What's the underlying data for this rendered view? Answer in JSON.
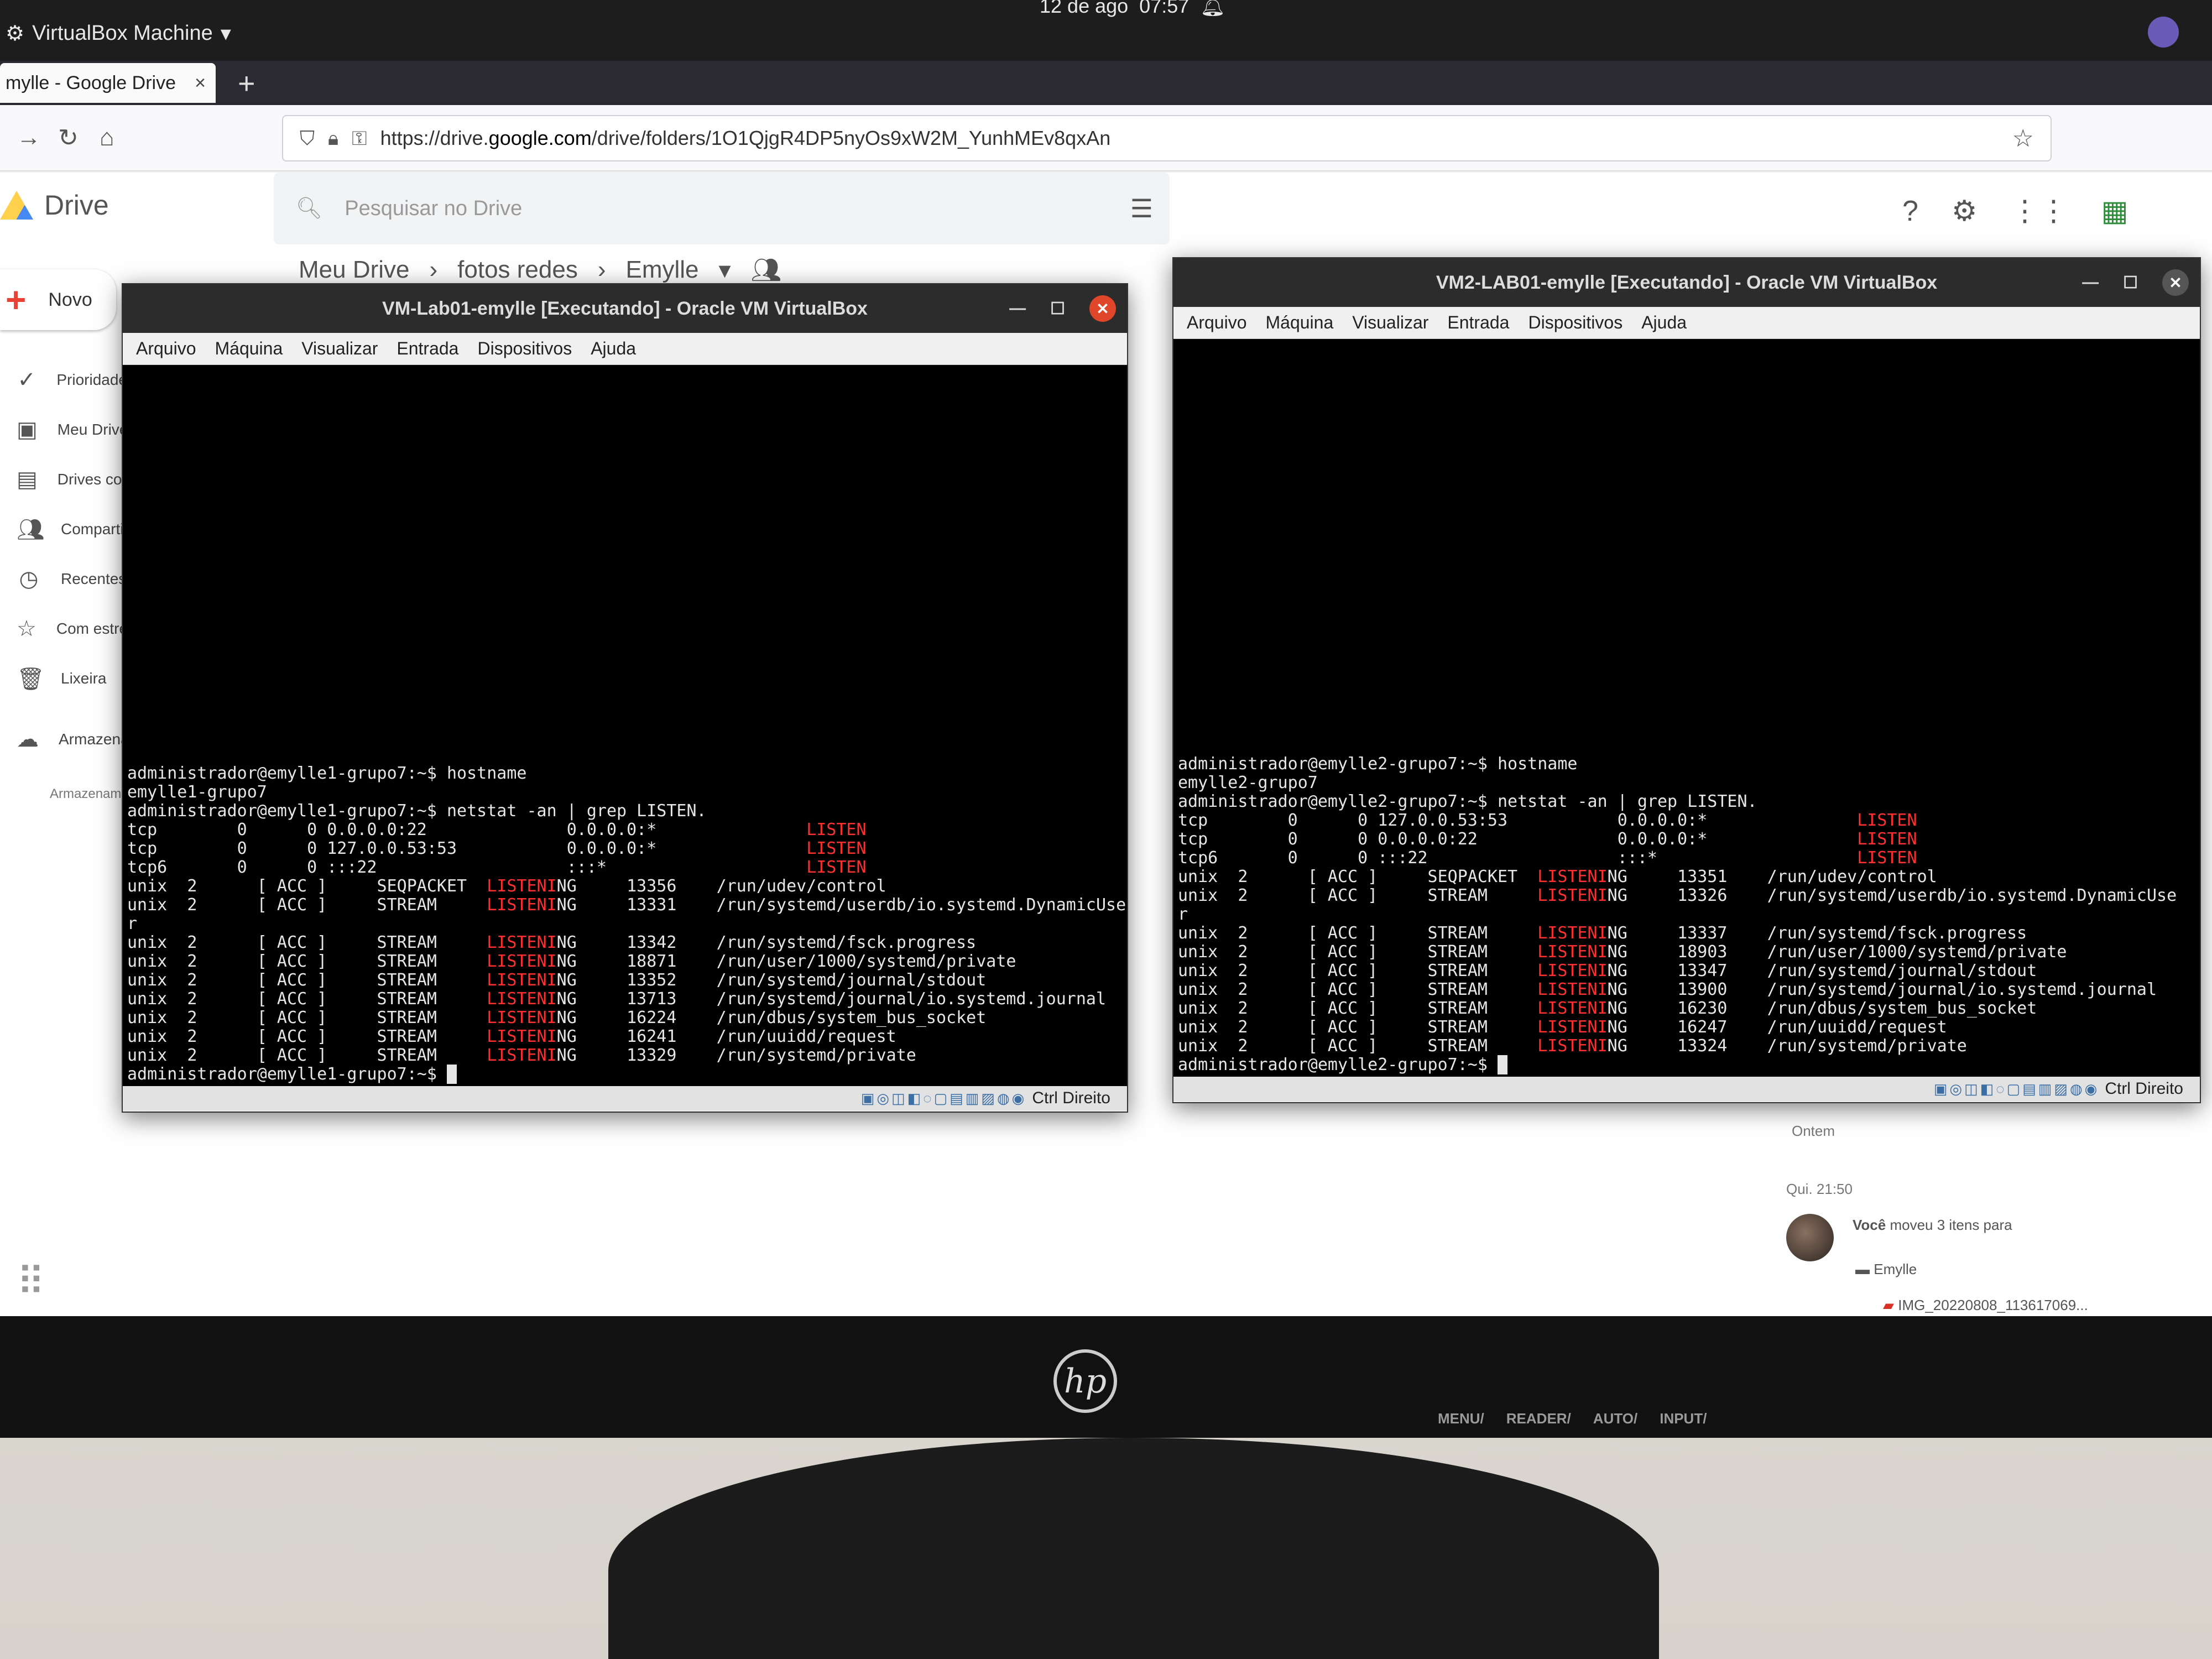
{
  "topbar": {
    "app_name": "VirtualBox Machine",
    "date": "12 de ago",
    "time": "07:57"
  },
  "browser": {
    "tab_title": "mylle - Google Drive",
    "url_prefix": "https://drive.",
    "url_domain": "google.com",
    "url_path": "/drive/folders/1O1QjgR4DP5nyOs9xW2M_YunhMEv8qxAn"
  },
  "drive": {
    "logo_text": "Drive",
    "search_placeholder": "Pesquisar no Drive",
    "breadcrumb": [
      "Meu Drive",
      "fotos redes",
      "Emylle"
    ],
    "new_label": "Novo",
    "nav": [
      {
        "icon": "check-circle-icon",
        "label": "Prioridade"
      },
      {
        "icon": "my-drive-icon",
        "label": "Meu Drive"
      },
      {
        "icon": "shared-drives-icon",
        "label": "Drives compartilhados"
      },
      {
        "icon": "people-icon",
        "label": "Compartilhados comigo"
      },
      {
        "icon": "clock-icon",
        "label": "Recentes"
      },
      {
        "icon": "star-icon",
        "label": "Com estrela"
      },
      {
        "icon": "trash-icon",
        "label": "Lixeira"
      },
      {
        "icon": "cloud-icon",
        "label": "Armazenamento"
      }
    ],
    "storage_note": "Armazenamento u",
    "activity": {
      "day_label": "Ontem",
      "time_label": "Qui. 21:50",
      "actor": "Você",
      "action": "moveu 3 itens para",
      "folder": "Emylle",
      "file": "IMG_20220808_113617069..."
    }
  },
  "vm1": {
    "title": "VM-Lab01-emylle [Executando] - Oracle VM VirtualBox",
    "menu": [
      "Arquivo",
      "Máquina",
      "Visualizar",
      "Entrada",
      "Dispositivos",
      "Ajuda"
    ],
    "host_key": "Ctrl Direito",
    "lines": [
      [
        "administrador@emylle1-grupo7:~$ hostname",
        ""
      ],
      [
        "emylle1-grupo7",
        ""
      ],
      [
        "administrador@emylle1-grupo7:~$ netstat -an | grep LISTEN.",
        ""
      ],
      [
        "tcp        0      0 0.0.0.0:22              0.0.0.0:*               ",
        "LISTEN"
      ],
      [
        "tcp        0      0 127.0.0.53:53           0.0.0.0:*               ",
        "LISTEN"
      ],
      [
        "tcp6       0      0 :::22                   :::*                    ",
        "LISTEN"
      ],
      [
        "unix  2      [ ACC ]     SEQPACKET  ",
        "LISTENI",
        "NG     13356    /run/udev/control"
      ],
      [
        "unix  2      [ ACC ]     STREAM     ",
        "LISTENI",
        "NG     13331    /run/systemd/userdb/io.systemd.DynamicUse"
      ],
      [
        "r",
        ""
      ],
      [
        "unix  2      [ ACC ]     STREAM     ",
        "LISTENI",
        "NG     13342    /run/systemd/fsck.progress"
      ],
      [
        "unix  2      [ ACC ]     STREAM     ",
        "LISTENI",
        "NG     18871    /run/user/1000/systemd/private"
      ],
      [
        "unix  2      [ ACC ]     STREAM     ",
        "LISTENI",
        "NG     13352    /run/systemd/journal/stdout"
      ],
      [
        "unix  2      [ ACC ]     STREAM     ",
        "LISTENI",
        "NG     13713    /run/systemd/journal/io.systemd.journal"
      ],
      [
        "unix  2      [ ACC ]     STREAM     ",
        "LISTENI",
        "NG     16224    /run/dbus/system_bus_socket"
      ],
      [
        "unix  2      [ ACC ]     STREAM     ",
        "LISTENI",
        "NG     16241    /run/uuidd/request"
      ],
      [
        "unix  2      [ ACC ]     STREAM     ",
        "LISTENI",
        "NG     13329    /run/systemd/private"
      ],
      [
        "administrador@emylle1-grupo7:~$ ",
        ""
      ]
    ]
  },
  "vm2": {
    "title": "VM2-LAB01-emylle [Executando] - Oracle VM VirtualBox",
    "menu": [
      "Arquivo",
      "Máquina",
      "Visualizar",
      "Entrada",
      "Dispositivos",
      "Ajuda"
    ],
    "host_key": "Ctrl Direito",
    "lines": [
      [
        "administrador@emylle2-grupo7:~$ hostname",
        ""
      ],
      [
        "emylle2-grupo7",
        ""
      ],
      [
        "administrador@emylle2-grupo7:~$ netstat -an | grep LISTEN.",
        ""
      ],
      [
        "tcp        0      0 127.0.0.53:53           0.0.0.0:*               ",
        "LISTEN"
      ],
      [
        "tcp        0      0 0.0.0.0:22              0.0.0.0:*               ",
        "LISTEN"
      ],
      [
        "tcp6       0      0 :::22                   :::*                    ",
        "LISTEN"
      ],
      [
        "unix  2      [ ACC ]     SEQPACKET  ",
        "LISTENI",
        "NG     13351    /run/udev/control"
      ],
      [
        "unix  2      [ ACC ]     STREAM     ",
        "LISTENI",
        "NG     13326    /run/systemd/userdb/io.systemd.DynamicUse"
      ],
      [
        "r",
        ""
      ],
      [
        "unix  2      [ ACC ]     STREAM     ",
        "LISTENI",
        "NG     13337    /run/systemd/fsck.progress"
      ],
      [
        "unix  2      [ ACC ]     STREAM     ",
        "LISTENI",
        "NG     18903    /run/user/1000/systemd/private"
      ],
      [
        "unix  2      [ ACC ]     STREAM     ",
        "LISTENI",
        "NG     13347    /run/systemd/journal/stdout"
      ],
      [
        "unix  2      [ ACC ]     STREAM     ",
        "LISTENI",
        "NG     13900    /run/systemd/journal/io.systemd.journal"
      ],
      [
        "unix  2      [ ACC ]     STREAM     ",
        "LISTENI",
        "NG     16230    /run/dbus/system_bus_socket"
      ],
      [
        "unix  2      [ ACC ]     STREAM     ",
        "LISTENI",
        "NG     16247    /run/uuidd/request"
      ],
      [
        "unix  2      [ ACC ]     STREAM     ",
        "LISTENI",
        "NG     13324    /run/systemd/private"
      ],
      [
        "administrador@emylle2-grupo7:~$ ",
        ""
      ]
    ]
  },
  "monitor": {
    "osd": [
      "MENU/",
      "READER/",
      "AUTO/",
      "INPUT/"
    ]
  }
}
